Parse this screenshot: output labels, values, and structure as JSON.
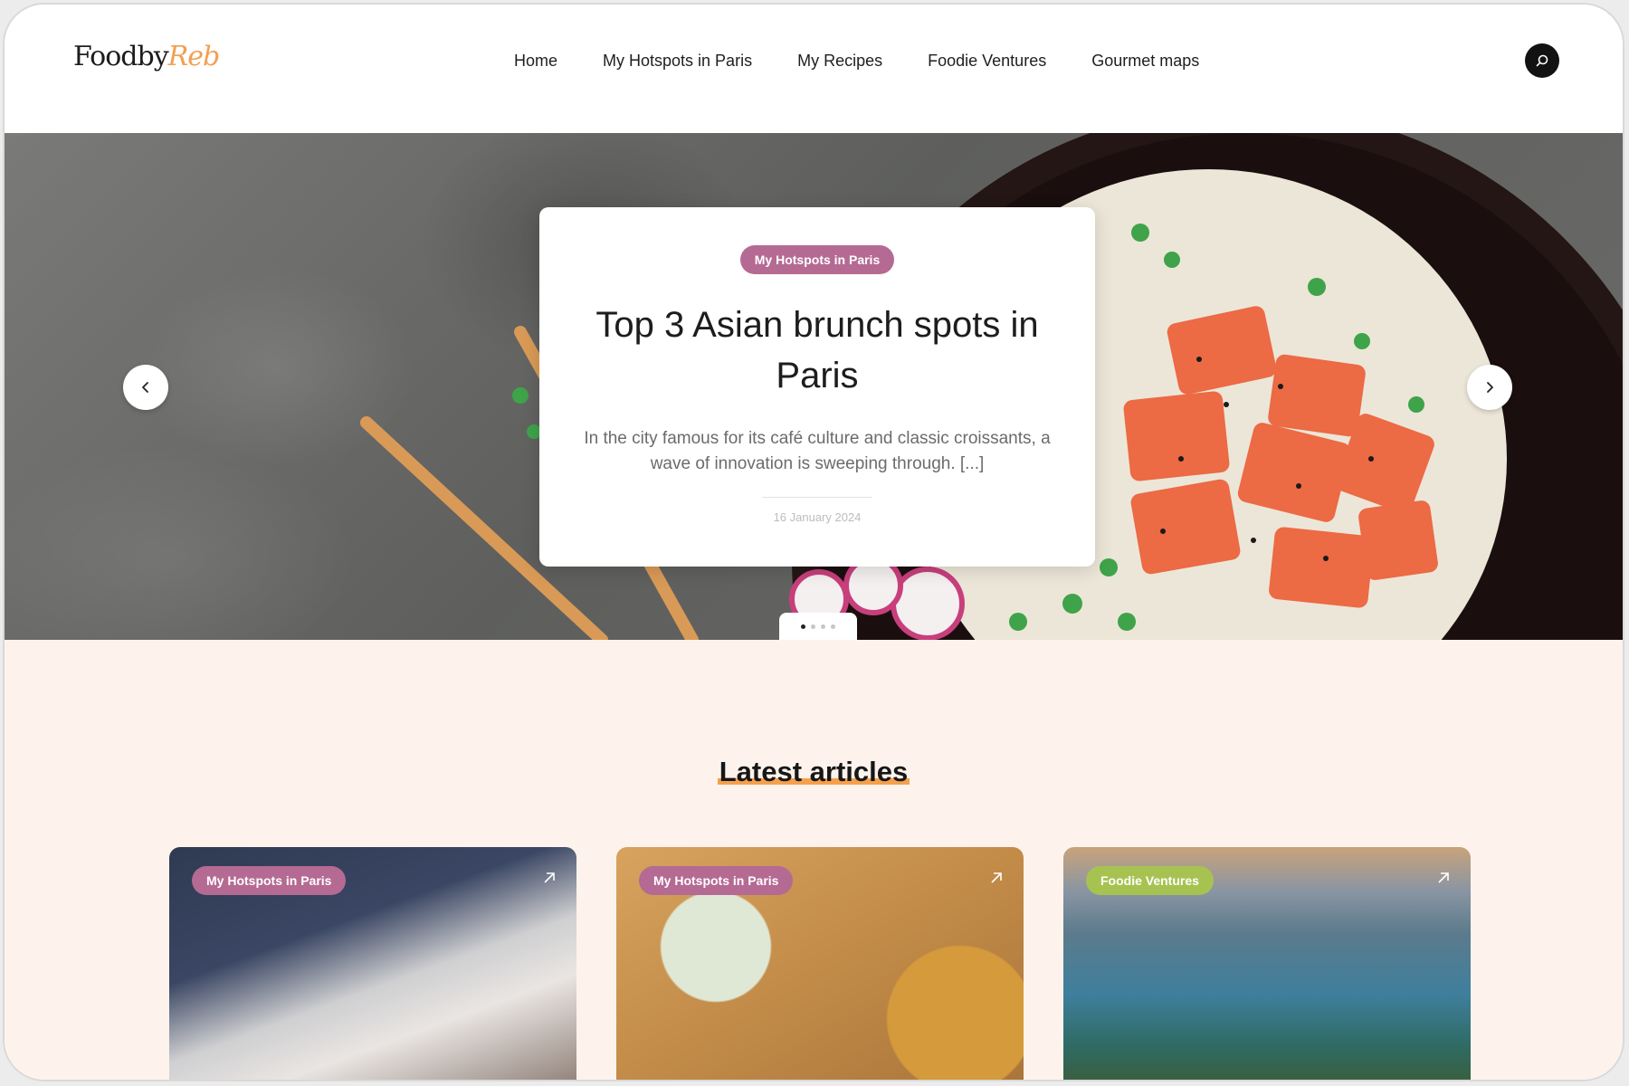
{
  "logo": {
    "part1": "Foodby",
    "part2": "Reb"
  },
  "nav": [
    {
      "label": "Home"
    },
    {
      "label": "My Hotspots in Paris"
    },
    {
      "label": "My Recipes"
    },
    {
      "label": "Foodie Ventures"
    },
    {
      "label": "Gourmet maps"
    }
  ],
  "icons": {
    "search": "search-icon",
    "prev": "chevron-left-icon",
    "next": "chevron-right-icon",
    "open": "arrow-up-right-icon"
  },
  "hero": {
    "tag": "My Hotspots in Paris",
    "title": "Top 3 Asian brunch spots in Paris",
    "excerpt": "In the city famous for its café culture and classic croissants, a wave of innovation is sweeping through. [...]",
    "date": "16 January 2024",
    "slide_count": 4,
    "active_slide": 1
  },
  "latest": {
    "heading": "Latest articles",
    "articles": [
      {
        "tag": "My Hotspots in Paris",
        "tag_color": "#b56a93"
      },
      {
        "tag": "My Hotspots in Paris",
        "tag_color": "#b56a93"
      },
      {
        "tag": "Foodie Ventures",
        "tag_color": "#a6c352"
      }
    ]
  },
  "colors": {
    "accent": "#f4a04d",
    "pink_tag": "#b56a93",
    "green_tag": "#a6c352",
    "cream_bg": "#fdf3ec"
  }
}
